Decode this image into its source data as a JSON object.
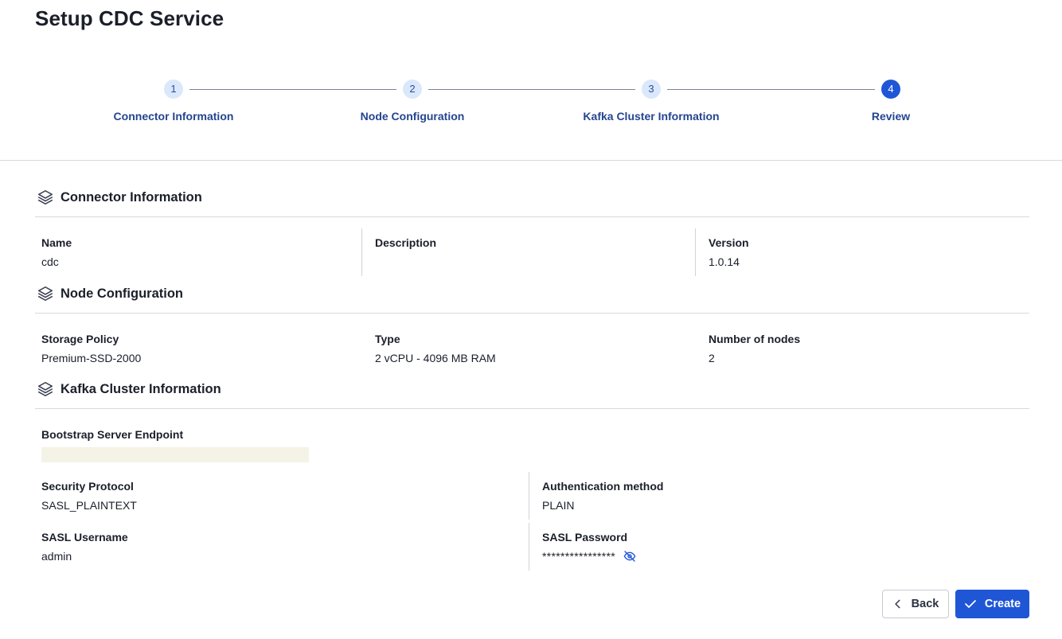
{
  "page": {
    "title": "Setup CDC Service"
  },
  "stepper": {
    "steps": [
      {
        "number": "1",
        "label": "Connector Information"
      },
      {
        "number": "2",
        "label": "Node Configuration"
      },
      {
        "number": "3",
        "label": "Kafka Cluster Information"
      },
      {
        "number": "4",
        "label": "Review"
      }
    ],
    "active_step": 4
  },
  "connector": {
    "title": "Connector Information",
    "icon": "layers-icon",
    "name_label": "Name",
    "name_value": "cdc",
    "description_label": "Description",
    "description_value": "",
    "version_label": "Version",
    "version_value": "1.0.14"
  },
  "node": {
    "title": "Node Configuration",
    "icon": "layers-icon",
    "storage_label": "Storage Policy",
    "storage_value": "Premium-SSD-2000",
    "type_label": "Type",
    "type_value": "2 vCPU - 4096 MB RAM",
    "nodes_label": "Number of nodes",
    "nodes_value": "2"
  },
  "kafka": {
    "title": "Kafka Cluster Information",
    "icon": "layers-icon",
    "bootstrap_label": "Bootstrap Server Endpoint",
    "security_label": "Security Protocol",
    "security_value": "SASL_PLAINTEXT",
    "auth_label": "Authentication method",
    "auth_value": "PLAIN",
    "username_label": "SASL Username",
    "username_value": "admin",
    "password_label": "SASL Password",
    "password_value": "****************",
    "password_toggle_icon": "eye-off-icon"
  },
  "actions": {
    "back_label": "Back",
    "create_label": "Create"
  },
  "colors": {
    "primary": "#1f56d6",
    "step_inactive_bg": "#dbe8fb",
    "step_label": "#24458f",
    "redacted_bg": "#f5f2e6"
  }
}
